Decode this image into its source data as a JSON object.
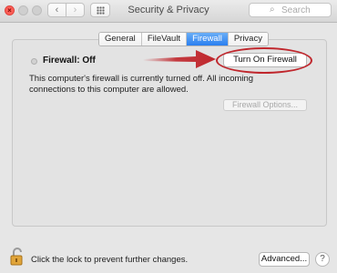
{
  "window": {
    "title": "Security & Privacy",
    "search_placeholder": "Search"
  },
  "toolbar": {
    "back_icon": "chevron-left",
    "forward_icon": "chevron-right",
    "grid_icon": "grid"
  },
  "tabs": [
    {
      "label": "General",
      "active": false
    },
    {
      "label": "FileVault",
      "active": false
    },
    {
      "label": "Firewall",
      "active": true
    },
    {
      "label": "Privacy",
      "active": false
    }
  ],
  "firewall": {
    "status_label": "Firewall: Off",
    "turn_on_label": "Turn On Firewall",
    "description": "This computer's firewall is currently turned off. All incoming connections to this computer are allowed.",
    "options_label": "Firewall Options..."
  },
  "footer": {
    "lock_text": "Click the lock to prevent further changes.",
    "advanced_label": "Advanced...",
    "help_label": "?"
  },
  "colors": {
    "annotation_red": "#c0272d",
    "tab_active": "#2a7ff0",
    "close_red": "#fc5f57"
  }
}
